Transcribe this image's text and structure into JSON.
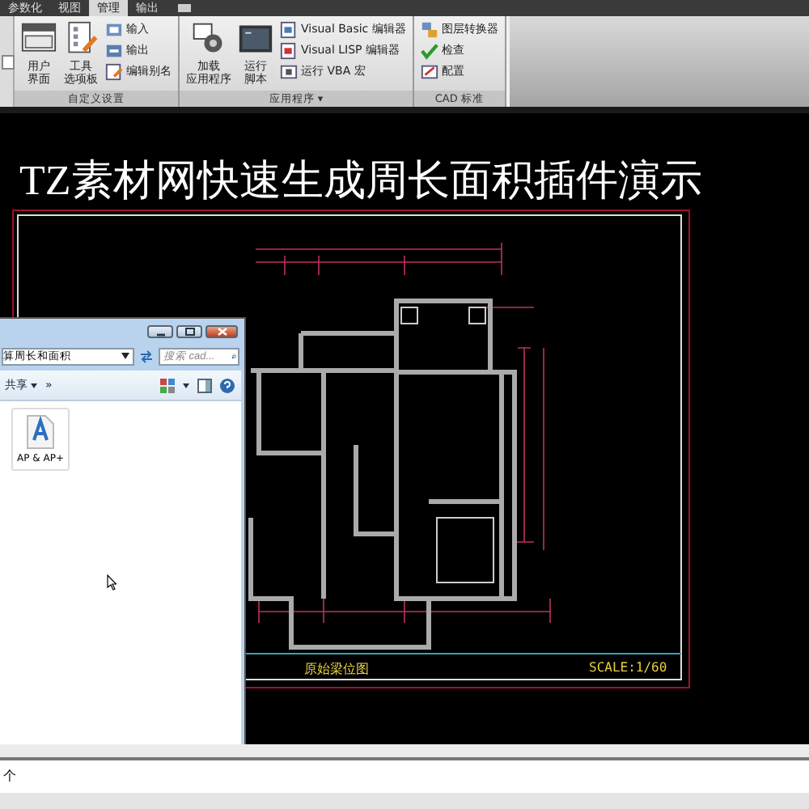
{
  "ribbon": {
    "tabs": [
      {
        "label": "参数化",
        "selected": false
      },
      {
        "label": "视图",
        "selected": false
      },
      {
        "label": "管理",
        "selected": true
      },
      {
        "label": "输出",
        "selected": false
      }
    ],
    "panels": [
      {
        "title": "自定义设置",
        "large_buttons": [
          {
            "lines": [
              "用户",
              "界面"
            ]
          },
          {
            "lines": [
              "工具",
              "选项板"
            ]
          }
        ],
        "small_buttons": [
          "输入",
          "输出",
          "编辑别名"
        ]
      },
      {
        "title": "应用程序 ▾",
        "large_buttons": [
          {
            "lines": [
              "加载",
              "应用程序"
            ]
          },
          {
            "lines": [
              "运行",
              "脚本"
            ]
          }
        ],
        "small_buttons": [
          "Visual Basic 编辑器",
          "Visual LISP 编辑器",
          "运行 VBA 宏"
        ]
      },
      {
        "title": "CAD 标准",
        "small_buttons": [
          "图层转换器",
          "检查",
          "配置"
        ]
      }
    ]
  },
  "drawing": {
    "title": "TZ素材网快速生成周长面积插件演示",
    "sheet_name": "原始梁位图",
    "scale": "SCALE:1/60"
  },
  "explorer": {
    "address": "算周长和面积",
    "search": {
      "placeholder": "搜索 cad..."
    },
    "share": "共享",
    "more": "»",
    "files": [
      {
        "name": "AP & AP+",
        "selected": false
      }
    ]
  },
  "command_line": {
    "text": "个"
  }
}
